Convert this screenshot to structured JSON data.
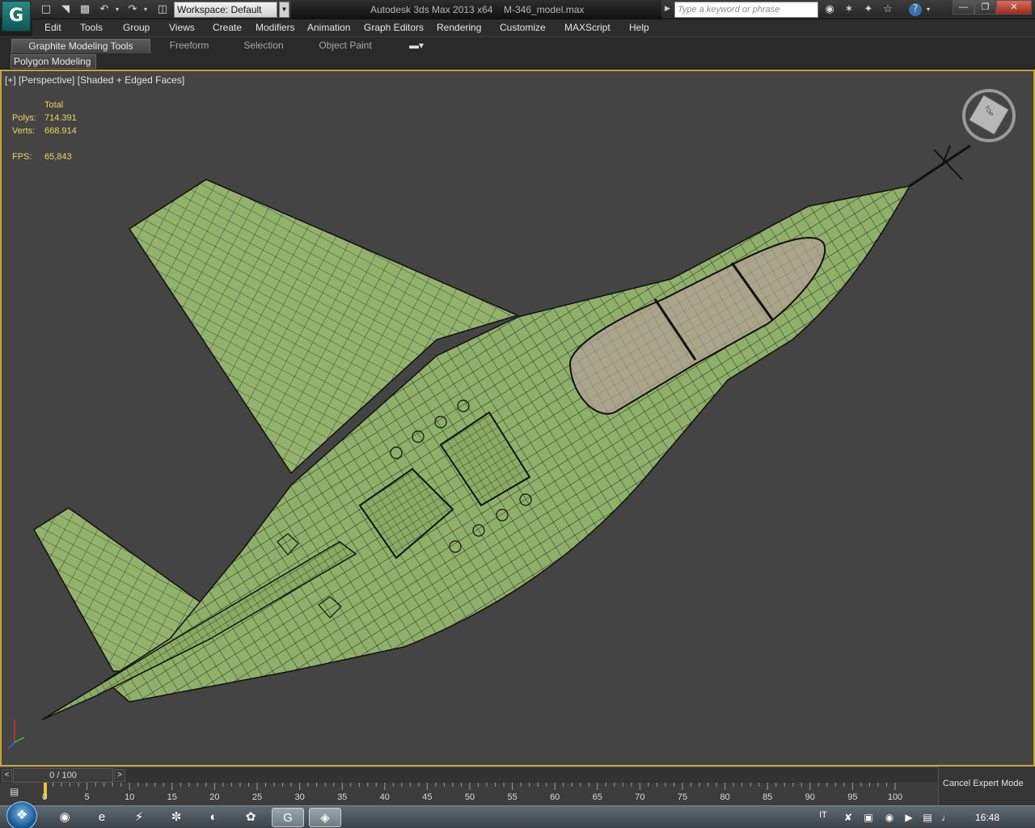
{
  "titlebar": {
    "workspace": "Workspace: Default",
    "app_name": "Autodesk 3ds Max  2013 x64",
    "file_name": "M-346_model.max",
    "search_placeholder": "Type a keyword or phrase"
  },
  "menu": [
    "Edit",
    "Tools",
    "Group",
    "Views",
    "Create",
    "Modifiers",
    "Animation",
    "Graph Editors",
    "Rendering",
    "Customize",
    "MAXScript",
    "Help"
  ],
  "ribbon": {
    "tabs": [
      "Graphite Modeling Tools",
      "Freeform",
      "Selection",
      "Object Paint"
    ],
    "panel": "Polygon Modeling"
  },
  "viewport": {
    "plus": "[+]",
    "view": "[Perspective]",
    "shading": "[Shaded + Edged Faces]",
    "stats_header": "Total",
    "polys_label": "Polys:",
    "polys_value": "714.391",
    "verts_label": "Verts:",
    "verts_value": "668.914",
    "fps_label": "FPS:",
    "fps_value": "65,843",
    "viewcube_face": "TOP"
  },
  "timeline": {
    "frame_display": "0 / 100",
    "ticks": [
      "0",
      "5",
      "10",
      "15",
      "20",
      "25",
      "30",
      "35",
      "40",
      "45",
      "50",
      "55",
      "60",
      "65",
      "70",
      "75",
      "80",
      "85",
      "90",
      "95",
      "100"
    ],
    "cancel_expert": "Cancel Expert Mode"
  },
  "taskbar": {
    "language": "IT",
    "clock": "16:48"
  },
  "colors": {
    "viewport_bg": "#444444",
    "model_green": "#8fb06a",
    "canopy": "#a8a48c",
    "stats_yellow": "#e9d65e",
    "active_border": "#c9a436"
  }
}
